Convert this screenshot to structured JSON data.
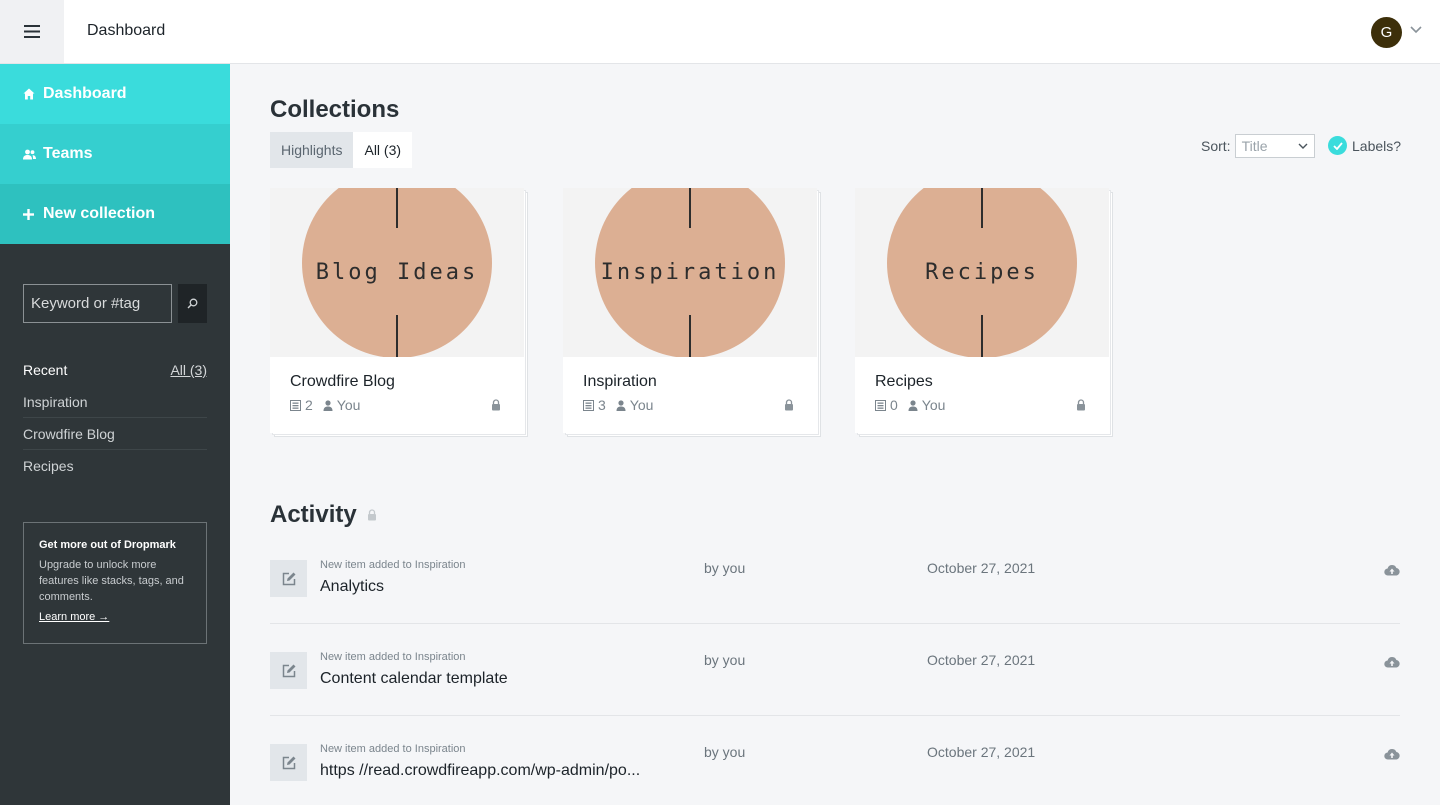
{
  "topbar": {
    "title": "Dashboard",
    "avatar_initial": "G"
  },
  "sidebar": {
    "nav": [
      {
        "label": "Dashboard",
        "icon": "home-icon"
      },
      {
        "label": "Teams",
        "icon": "users-icon"
      },
      {
        "label": "New collection",
        "icon": "plus-icon"
      }
    ],
    "search": {
      "placeholder": "Keyword or #tag"
    },
    "recent": {
      "heading": "Recent",
      "all_link": "All (3)",
      "items": [
        "Inspiration",
        "Crowdfire Blog",
        "Recipes"
      ]
    },
    "promo": {
      "title": "Get more out of Dropmark",
      "text": "Upgrade to unlock more features like stacks, tags, and comments.",
      "link": "Learn more →"
    }
  },
  "main": {
    "collections_heading": "Collections",
    "tabs": [
      {
        "label": "Highlights"
      },
      {
        "label": "All (3)"
      }
    ],
    "sort": {
      "label": "Sort:",
      "value": "Title"
    },
    "labels_toggle": "Labels?",
    "collections": [
      {
        "thumb_text": "Blog Ideas",
        "name": "Crowdfire Blog",
        "items": "2",
        "owner": "You"
      },
      {
        "thumb_text": "Inspiration",
        "name": "Inspiration",
        "items": "3",
        "owner": "You"
      },
      {
        "thumb_text": "Recipes",
        "name": "Recipes",
        "items": "0",
        "owner": "You"
      }
    ],
    "activity_heading": "Activity",
    "activity": [
      {
        "sub": "New item added to Inspiration",
        "title": "Analytics",
        "by": "by you",
        "date": "October 27, 2021"
      },
      {
        "sub": "New item added to Inspiration",
        "title": "Content calendar template",
        "by": "by you",
        "date": "October 27, 2021"
      },
      {
        "sub": "New item added to Inspiration",
        "title": "https //read.crowdfireapp.com/wp-admin/po...",
        "by": "by you",
        "date": "October 27, 2021"
      }
    ]
  },
  "colors": {
    "accent": "#3adcdc",
    "sidebar_bg": "#2f3639",
    "thumb_circle": "#dcaf93",
    "avatar_bg": "#3d2f0a"
  }
}
